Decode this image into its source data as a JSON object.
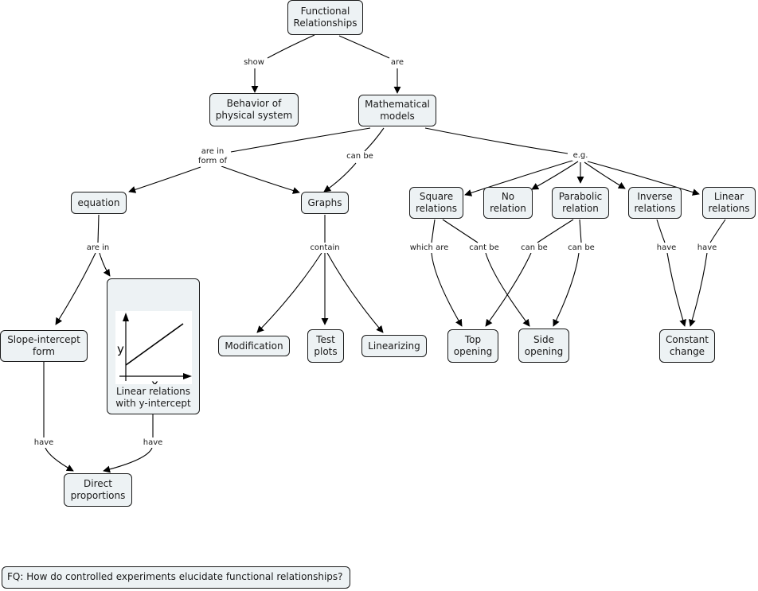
{
  "concept_map": {
    "nodes": [
      {
        "id": "functional-relationships",
        "label": "Functional\nRelationships"
      },
      {
        "id": "behavior-of-physical-system",
        "label": "Behavior of\nphysical system"
      },
      {
        "id": "mathematical-models",
        "label": "Mathematical\nmodels"
      },
      {
        "id": "equation",
        "label": "equation"
      },
      {
        "id": "graphs",
        "label": "Graphs"
      },
      {
        "id": "square-relations",
        "label": "Square\nrelations"
      },
      {
        "id": "no-relation",
        "label": "No\nrelation"
      },
      {
        "id": "parabolic-relation",
        "label": "Parabolic\nrelation"
      },
      {
        "id": "inverse-relations",
        "label": "Inverse\nrelations"
      },
      {
        "id": "linear-relations",
        "label": "Linear\nrelations"
      },
      {
        "id": "slope-intercept-form",
        "label": "Slope-intercept\nform"
      },
      {
        "id": "linear-relations-with-y-intercept",
        "label": "Linear relations\nwith y-intercept",
        "image": {
          "x_axis_label": "x",
          "y_axis_label": "y"
        }
      },
      {
        "id": "modification",
        "label": "Modification"
      },
      {
        "id": "test-plots",
        "label": "Test\nplots"
      },
      {
        "id": "linearizing",
        "label": "Linearizing"
      },
      {
        "id": "top-opening",
        "label": "Top\nopening"
      },
      {
        "id": "side-opening",
        "label": "Side\nopening"
      },
      {
        "id": "constant-change",
        "label": "Constant\nchange"
      },
      {
        "id": "direct-proportions",
        "label": "Direct\nproportions"
      }
    ],
    "linking_phrases": [
      {
        "id": "show",
        "label": "show"
      },
      {
        "id": "are",
        "label": "are"
      },
      {
        "id": "are-in-form-of",
        "label": "are in\nform of"
      },
      {
        "id": "can-be-graphs",
        "label": "can be"
      },
      {
        "id": "eg",
        "label": "e.g."
      },
      {
        "id": "are-in",
        "label": "are in"
      },
      {
        "id": "contain",
        "label": "contain"
      },
      {
        "id": "which-are",
        "label": "which are"
      },
      {
        "id": "cant-be",
        "label": "cant be"
      },
      {
        "id": "can-be-top",
        "label": "can be"
      },
      {
        "id": "can-be-side",
        "label": "can be"
      },
      {
        "id": "have-inverse",
        "label": "have"
      },
      {
        "id": "have-linear",
        "label": "have"
      },
      {
        "id": "have-slope",
        "label": "have"
      },
      {
        "id": "have-yint",
        "label": "have"
      }
    ],
    "links": [
      {
        "from": "functional-relationships",
        "via": "show",
        "to": "behavior-of-physical-system"
      },
      {
        "from": "functional-relationships",
        "via": "are",
        "to": "mathematical-models"
      },
      {
        "from": "mathematical-models",
        "via": "are in form of",
        "to": [
          "equation",
          "graphs"
        ]
      },
      {
        "from": "mathematical-models",
        "via": "can be",
        "to": "graphs"
      },
      {
        "from": "mathematical-models",
        "via": "e.g.",
        "to": [
          "square-relations",
          "no-relation",
          "parabolic-relation",
          "inverse-relations",
          "linear-relations"
        ]
      },
      {
        "from": "equation",
        "via": "are in",
        "to": [
          "slope-intercept-form",
          "linear-relations-with-y-intercept"
        ]
      },
      {
        "from": "graphs",
        "via": "contain",
        "to": [
          "modification",
          "test-plots",
          "linearizing"
        ]
      },
      {
        "from": "square-relations",
        "via": "which are",
        "to": "top-opening"
      },
      {
        "from": "square-relations",
        "via": "cant be",
        "to": "side-opening"
      },
      {
        "from": "parabolic-relation",
        "via": "can be",
        "to": "top-opening"
      },
      {
        "from": "parabolic-relation",
        "via": "can be",
        "to": "side-opening"
      },
      {
        "from": "inverse-relations",
        "via": "have",
        "to": "constant-change"
      },
      {
        "from": "linear-relations",
        "via": "have",
        "to": "constant-change"
      },
      {
        "from": "slope-intercept-form",
        "via": "have",
        "to": "direct-proportions"
      },
      {
        "from": "linear-relations-with-y-intercept",
        "via": "have",
        "to": "direct-proportions"
      }
    ],
    "focus_question": "FQ: How do controlled experiments elucidate functional relationships?"
  }
}
